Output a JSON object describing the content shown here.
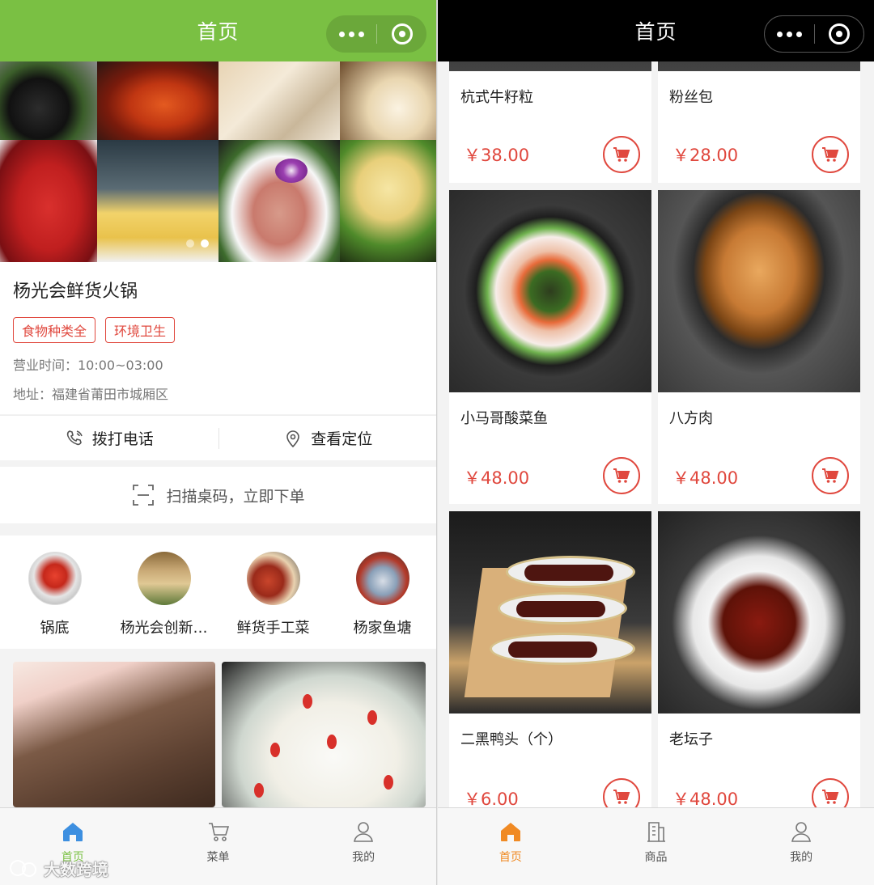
{
  "left": {
    "navbar": {
      "title": "首页"
    },
    "shop": {
      "name": "杨光会鲜货火锅",
      "tags": [
        "食物种类全",
        "环境卫生"
      ],
      "hours": "营业时间：10:00~03:00",
      "address": "地址：福建省莆田市城厢区"
    },
    "actions": {
      "call": "拨打电话",
      "location": "查看定位"
    },
    "scan": "扫描桌码，立即下单",
    "categories": [
      "锅底",
      "杨光会创新…",
      "鲜货手工菜",
      "杨家鱼塘"
    ],
    "tabs": [
      "首页",
      "菜单",
      "我的"
    ],
    "watermark": "大数跨境"
  },
  "right": {
    "navbar": {
      "title": "首页"
    },
    "products": [
      {
        "name": "杭式牛籽粒",
        "price": "￥38.00"
      },
      {
        "name": "粉丝包",
        "price": "￥28.00"
      },
      {
        "name": "小马哥酸菜鱼",
        "price": "￥48.00"
      },
      {
        "name": "八方肉",
        "price": "￥48.00"
      },
      {
        "name": "二黑鸭头（个）",
        "price": "￥6.00"
      },
      {
        "name": "老坛子",
        "price": "￥48.00"
      }
    ],
    "tabs": [
      "首页",
      "商品",
      "我的"
    ]
  },
  "colors": {
    "green": "#7ac043",
    "red": "#e0483e",
    "orange": "#f08a24"
  }
}
